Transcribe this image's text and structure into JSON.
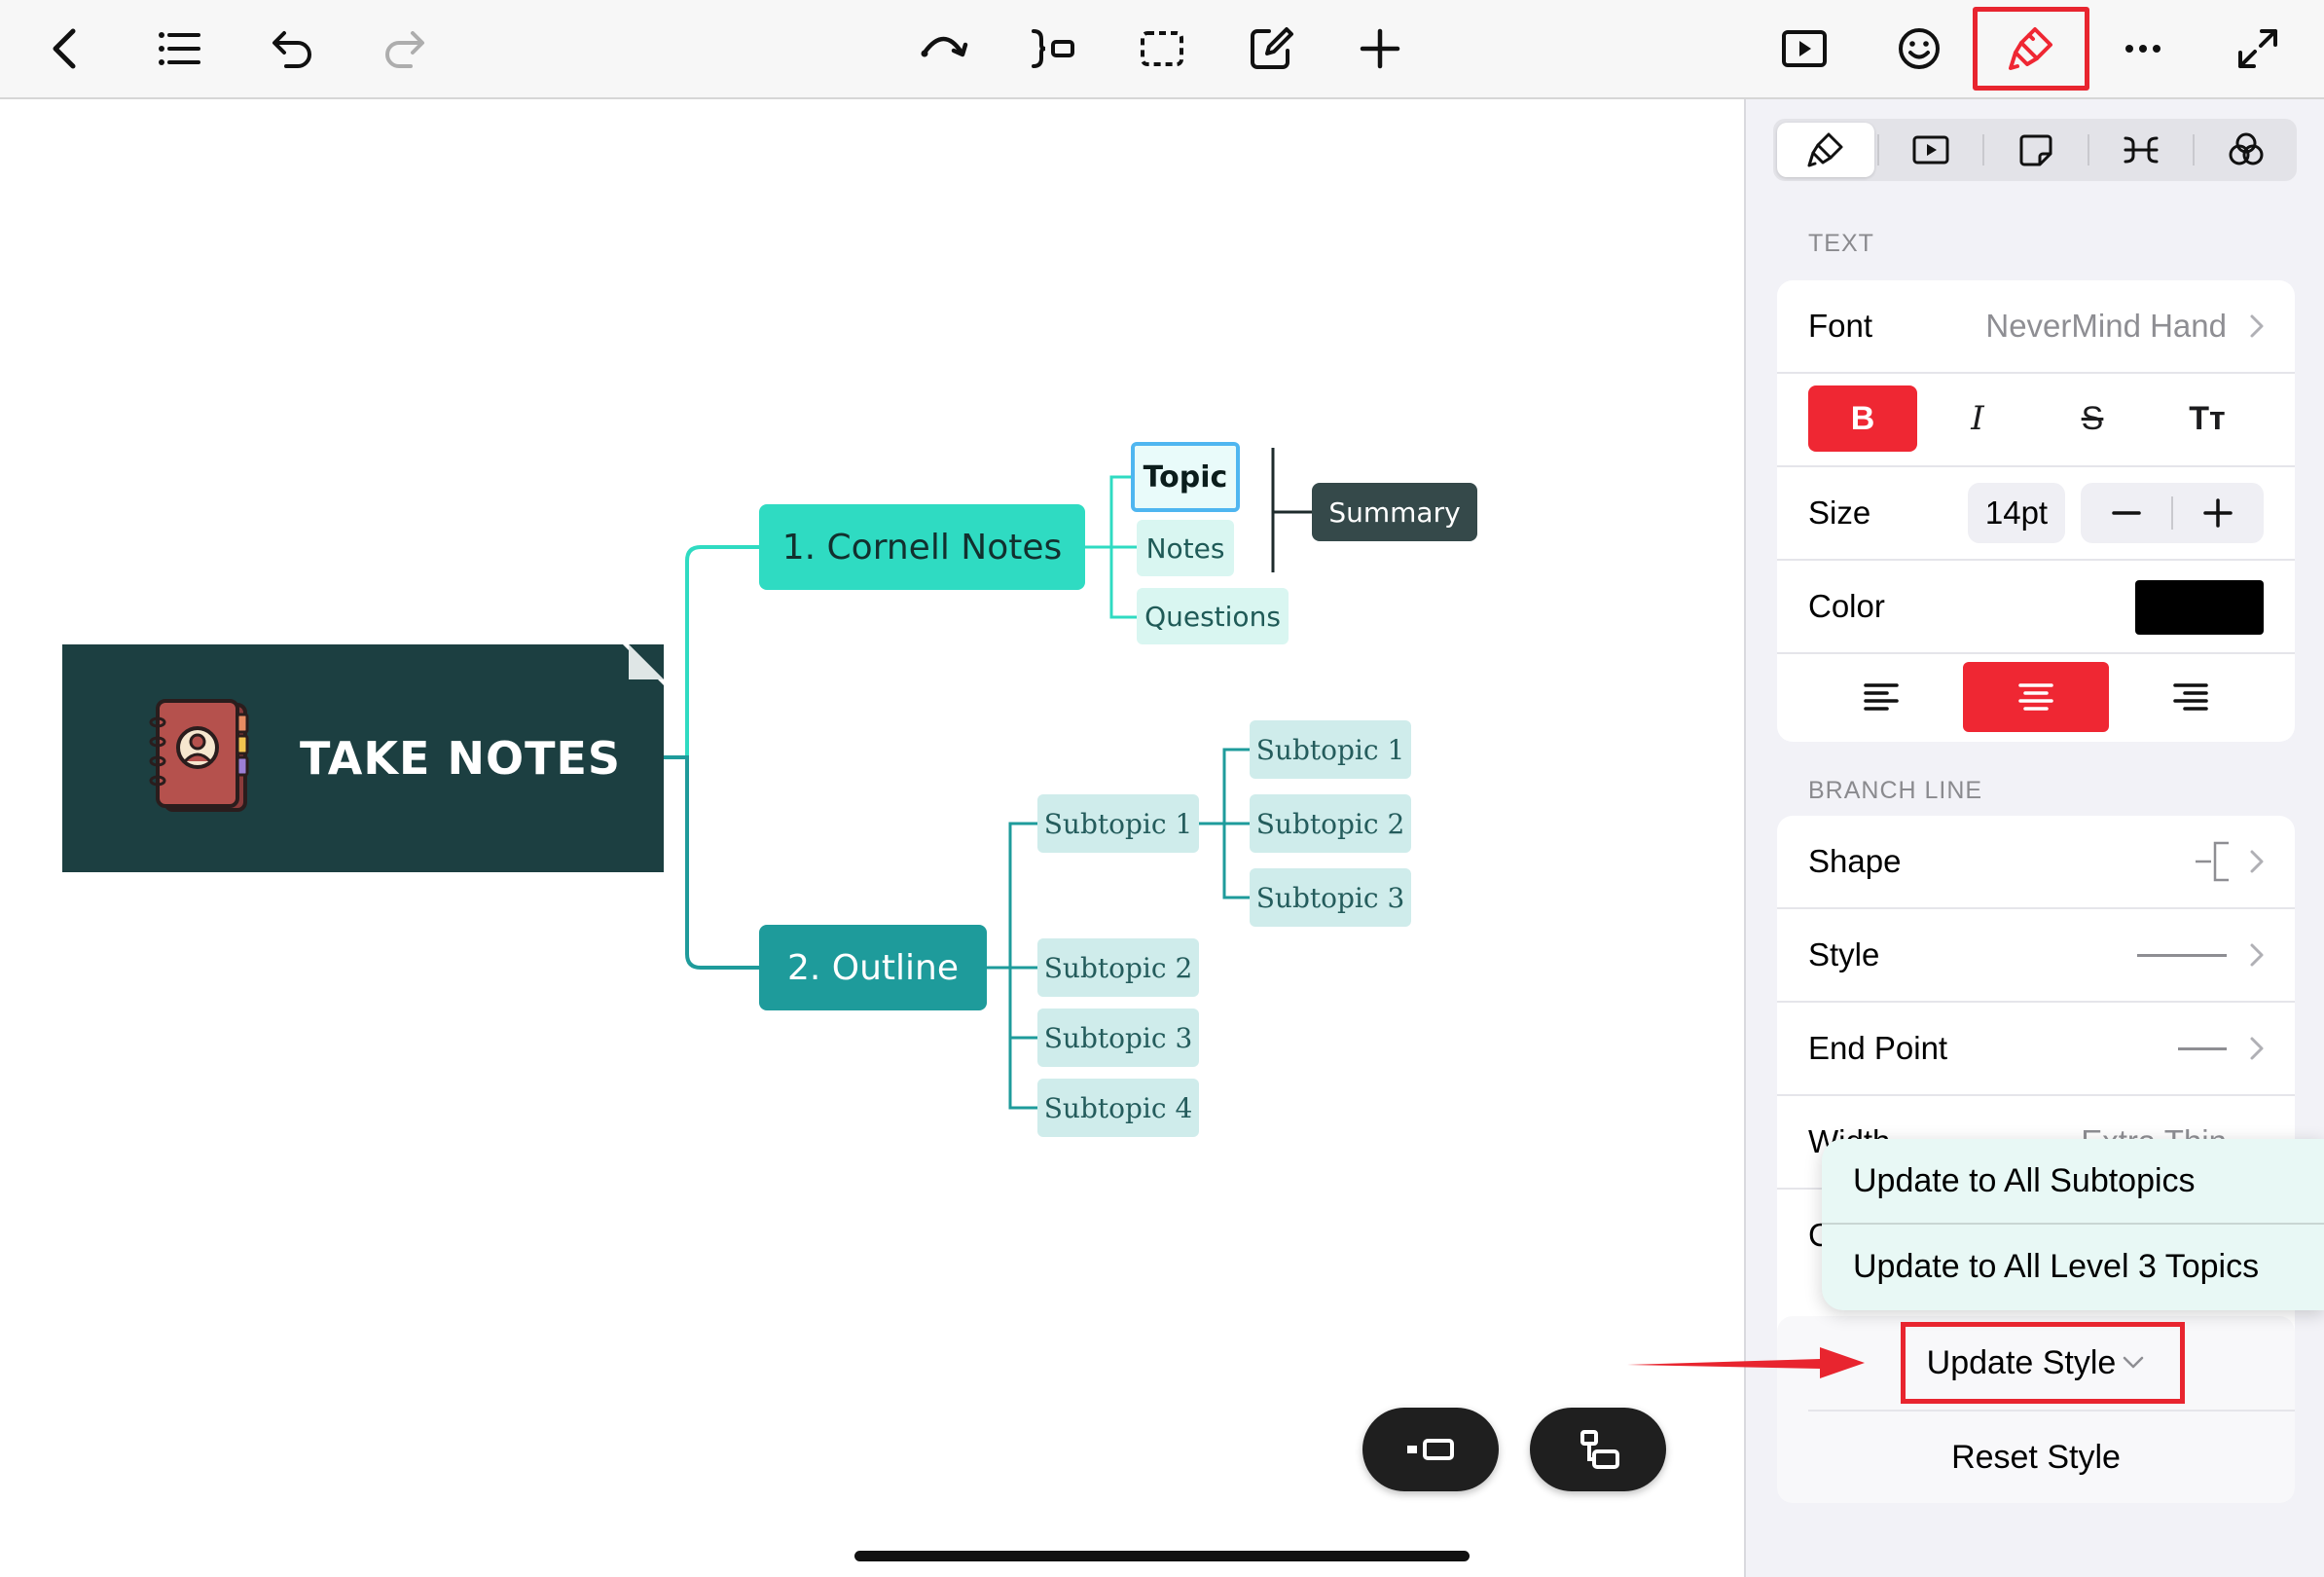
{
  "toolbar": {
    "left_icons": [
      "back-icon",
      "outline-list-icon",
      "undo-icon",
      "redo-icon"
    ],
    "center_icons": [
      "relationship-icon",
      "boundary-summary-icon",
      "select-area-icon",
      "edit-note-icon",
      "add-topic-icon"
    ],
    "right_icons": [
      "presentation-icon",
      "emoji-sticker-icon",
      "format-brush-icon",
      "more-icon",
      "fullscreen-icon"
    ],
    "highlight_color": "#e8252f"
  },
  "mindmap": {
    "root": {
      "label": "TAKE NOTES",
      "icon": "notebook-icon",
      "color": "#1c3f41"
    },
    "main_topics": [
      {
        "label": "1. Cornell Notes",
        "color": "#2fdbc2"
      },
      {
        "label": "2. Outline",
        "color": "#1e9b9b"
      }
    ],
    "cornell_children": [
      "Topic",
      "Notes",
      "Questions"
    ],
    "summary": {
      "label": "Summary"
    },
    "outline_children": [
      "Subtopic 1",
      "Subtopic 2",
      "Subtopic 3",
      "Subtopic 4"
    ],
    "outline_sub_children": [
      "Subtopic 1",
      "Subtopic 2",
      "Subtopic 3"
    ]
  },
  "floating_buttons": [
    "insert-subtopic-icon",
    "insert-topic-icon"
  ],
  "panel": {
    "tabs": [
      "style-brush-icon",
      "presentation-icon",
      "sticker-note-icon",
      "structure-icon",
      "theme-icon"
    ],
    "active_tab": 0,
    "text_section": {
      "header": "TEXT",
      "font_label": "Font",
      "font_value": "NeverMind Hand",
      "format_buttons": [
        "B",
        "I",
        "S",
        "Tт"
      ],
      "size_label": "Size",
      "size_value": "14pt",
      "color_label": "Color",
      "color_value": "#000000",
      "active_alignment": "center"
    },
    "branch_section": {
      "header": "BRANCH LINE",
      "shape_label": "Shape",
      "style_label": "Style",
      "end_point_label": "End Point",
      "width_label": "Width",
      "width_value": "Extra Thin",
      "color_label_partial": "C"
    },
    "update_style": "Update Style",
    "reset_style": "Reset Style"
  },
  "popover": {
    "items": [
      "Update to All Subtopics",
      "Update to All Level 3 Topics"
    ]
  },
  "accent_red": "#ef2733"
}
